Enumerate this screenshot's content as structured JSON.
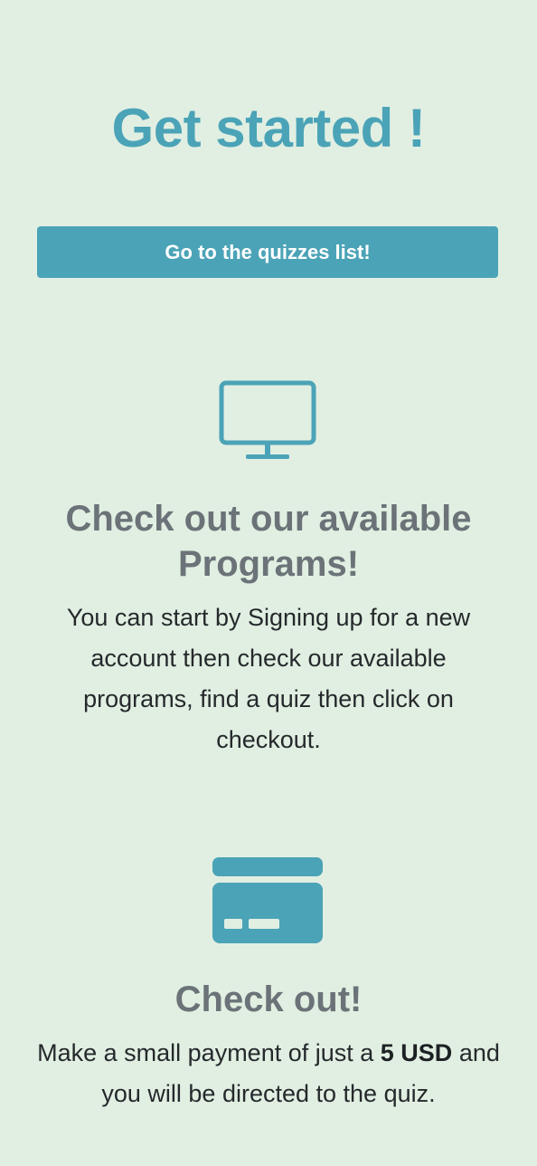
{
  "hero": {
    "title": "Get started !",
    "button_label": "Go to the quizzes list!"
  },
  "sections": [
    {
      "icon": "monitor-icon",
      "heading": "Check out our available Programs!",
      "text": "You can start by Signing up for a new account then check our available programs, find a quiz then click on checkout."
    },
    {
      "icon": "credit-card-icon",
      "heading": "Check out!",
      "text_before": "Make a small payment of just a ",
      "text_highlight": "5 USD",
      "text_after": " and you will be directed to the quiz."
    }
  ],
  "colors": {
    "background": "#e1efe2",
    "accent": "#4ba3b7",
    "heading": "#6b7378",
    "body_text": "#25292c"
  }
}
